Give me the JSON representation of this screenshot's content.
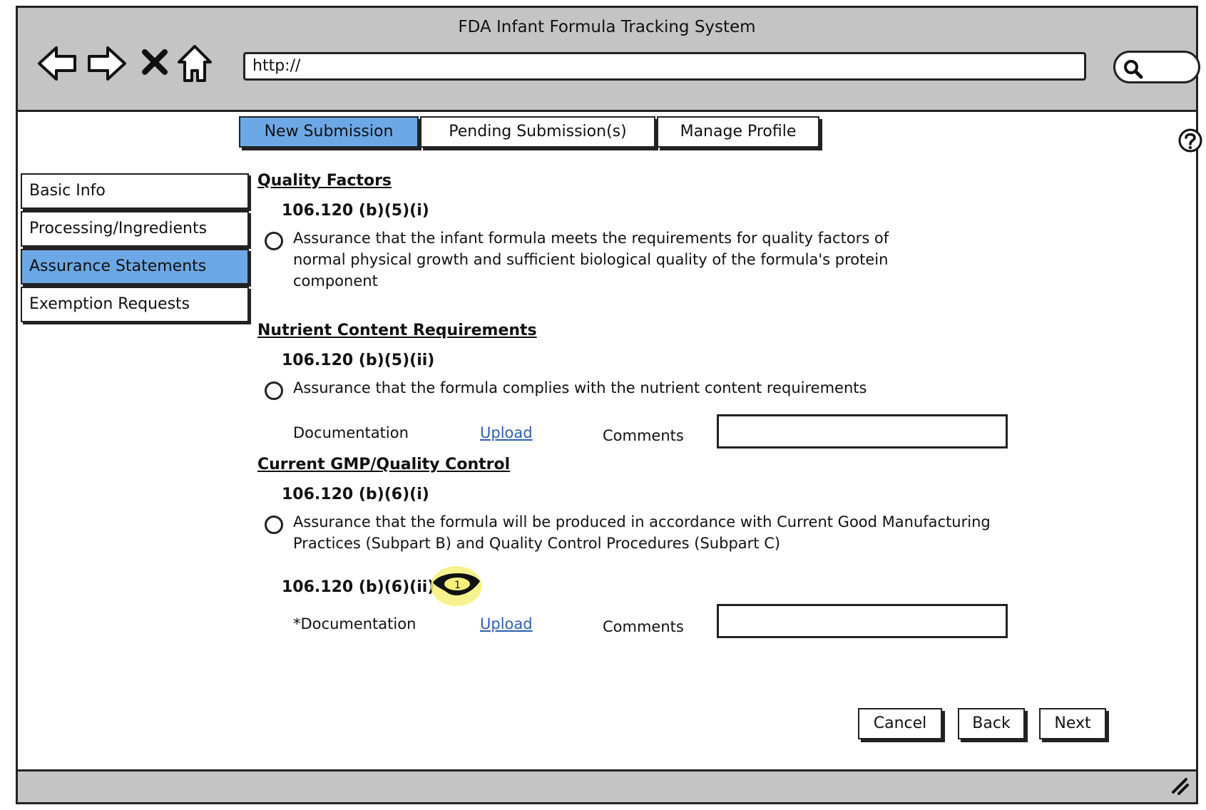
{
  "window": {
    "title": "FDA Infant Formula Tracking System",
    "url": "http://"
  },
  "icons": {
    "back": "back-arrow-icon",
    "forward": "forward-arrow-icon",
    "stop": "close-x-icon",
    "home": "home-icon",
    "search": "search-icon",
    "help": "help-icon",
    "resize": "resize-grip-icon"
  },
  "tabs": [
    {
      "label": "New Submission",
      "active": true
    },
    {
      "label": "Pending Submission(s)",
      "active": false
    },
    {
      "label": "Manage Profile",
      "active": false
    }
  ],
  "sidebar": {
    "items": [
      {
        "label": "Basic Info",
        "active": false
      },
      {
        "label": "Processing/Ingredients",
        "active": false
      },
      {
        "label": "Assurance Statements",
        "active": true
      },
      {
        "label": "Exemption Requests",
        "active": false
      }
    ]
  },
  "sections": {
    "quality": {
      "title": "Quality Factors",
      "code": "106.120 (b)(5)(i)",
      "statement_lines": [
        "Assurance that the infant formula meets the requirements for quality factors of",
        "normal physical growth and sufficient biological quality of the formula's protein",
        "component"
      ]
    },
    "nutrient": {
      "title": "Nutrient Content Requirements",
      "code": "106.120 (b)(5)(ii)",
      "statement": "Assurance that the formula complies with the nutrient content requirements",
      "documentation_label": "Documentation",
      "upload_label": "Upload",
      "comments_label": "Comments"
    },
    "gmp": {
      "title": "Current GMP/Quality Control",
      "code": "106.120 (b)(6)(i)",
      "statement_lines": [
        "Assurance that the formula will be produced in accordance with Current Good Manufacturing",
        "Practices (Subpart B) and  Quality Control Procedures (Subpart C)"
      ],
      "code2": "106.120 (b)(6)(ii)",
      "badge_number": "1",
      "documentation_label": "*Documentation",
      "upload_label": "Upload",
      "comments_label": "Comments"
    }
  },
  "buttons": {
    "cancel": "Cancel",
    "back": "Back",
    "next": "Next"
  },
  "colors": {
    "active_blue": "#6da8e6",
    "chrome_gray": "#c4c4c4",
    "link_blue": "#2b5fb3",
    "badge_yellow": "#f5f17a"
  }
}
